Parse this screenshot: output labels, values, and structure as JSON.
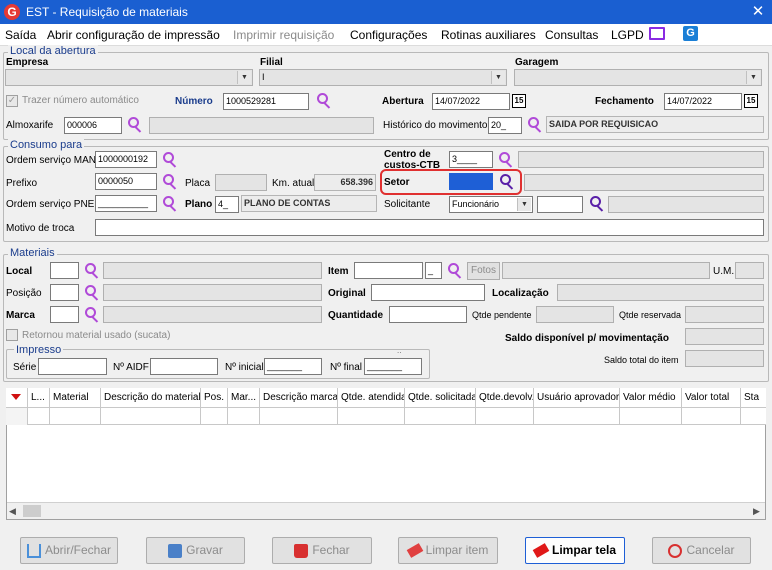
{
  "window": {
    "title": "EST - Requisição de materiais",
    "close_glyph": "✕",
    "logo_letter": "G"
  },
  "menu": [
    "Saída",
    "Abrir configuração de impressão",
    "Imprimir requisição",
    "Configurações",
    "Rotinas auxiliares",
    "Consultas",
    "LGPD"
  ],
  "abertura": {
    "legend": "Local da abertura",
    "empresa_label": "Empresa",
    "filial_label": "Filial",
    "filial_value": "I",
    "garagem_label": "Garagem",
    "trazer_label": "Trazer número automático",
    "numero_label": "Número",
    "numero_value": "1000529281",
    "abertura_label": "Abertura",
    "abertura_value": "14/07/2022",
    "fechamento_label": "Fechamento",
    "fechamento_value": "14/07/2022",
    "almoxarife_label": "Almoxarife",
    "almoxarife_value": "000006",
    "historico_label": "Histórico do movimento",
    "historico_value": "20_",
    "historico_desc": "SAIDA POR REQUISICAO",
    "cal_glyph": "15"
  },
  "consumo": {
    "legend": "Consumo para",
    "os_man_label": "Ordem serviço MAN",
    "os_man_value": "1000000192",
    "centro_label": "Centro de custos-CTB",
    "centro_value": "3____",
    "prefixo_label": "Prefixo",
    "prefixo_value": "0000050",
    "placa_label": "Placa",
    "km_label": "Km. atual",
    "km_value": "658.396",
    "setor_label": "Setor",
    "os_pne_label": "Ordem serviço PNE",
    "os_pne_value": "__________",
    "plano_label": "Plano",
    "plano_code": "4_",
    "plano_desc": "PLANO DE CONTAS",
    "solicitante_label": "Solicitante",
    "solicitante_value": "Funcionário",
    "motivo_label": "Motivo de troca"
  },
  "materiais": {
    "legend": "Materiais",
    "local_label": "Local",
    "posicao_label": "Posição",
    "marca_label": "Marca",
    "item_label": "Item",
    "item_suffix": "_",
    "fotos_label": "Fotos",
    "um_label": "U.M.",
    "original_label": "Original",
    "localizacao_label": "Localização",
    "quantidade_label": "Quantidade",
    "qtde_pendente_label": "Qtde pendente",
    "qtde_reservada_label": "Qtde reservada",
    "retornou_label": "Retornou material usado (sucata)",
    "saldo_disp_label": "Saldo disponível p/ movimentação",
    "saldo_total_label": "Saldo total do item",
    "impresso": {
      "legend": "Impresso",
      "serie_label": "Série",
      "aidf_label": "Nº AIDF",
      "inicial_label": "Nº inicial",
      "inicial_value": "_______",
      "final_label": "Nº final",
      "final_value": "_______",
      "dots": ".."
    }
  },
  "grid": {
    "columns": [
      "L...",
      "Material",
      "Descrição do material",
      "Pos.",
      "Mar...",
      "Descrição marca",
      "Qtde. atendida",
      "Qtde. solicitada",
      "Qtde.devolv.",
      "Usuário aprovador",
      "Valor médio",
      "Valor total",
      "Sta"
    ]
  },
  "buttons": {
    "abrir": "Abrir/Fechar",
    "gravar": "Gravar",
    "fechar": "Fechar",
    "limpar_item": "Limpar item",
    "limpar_tela": "Limpar tela",
    "cancelar": "Cancelar"
  },
  "colors": {
    "titlebar": "#1a5fd1",
    "accent": "#1e5fd6",
    "search_icon": "#b04ad8",
    "highlight": "#e03030"
  }
}
